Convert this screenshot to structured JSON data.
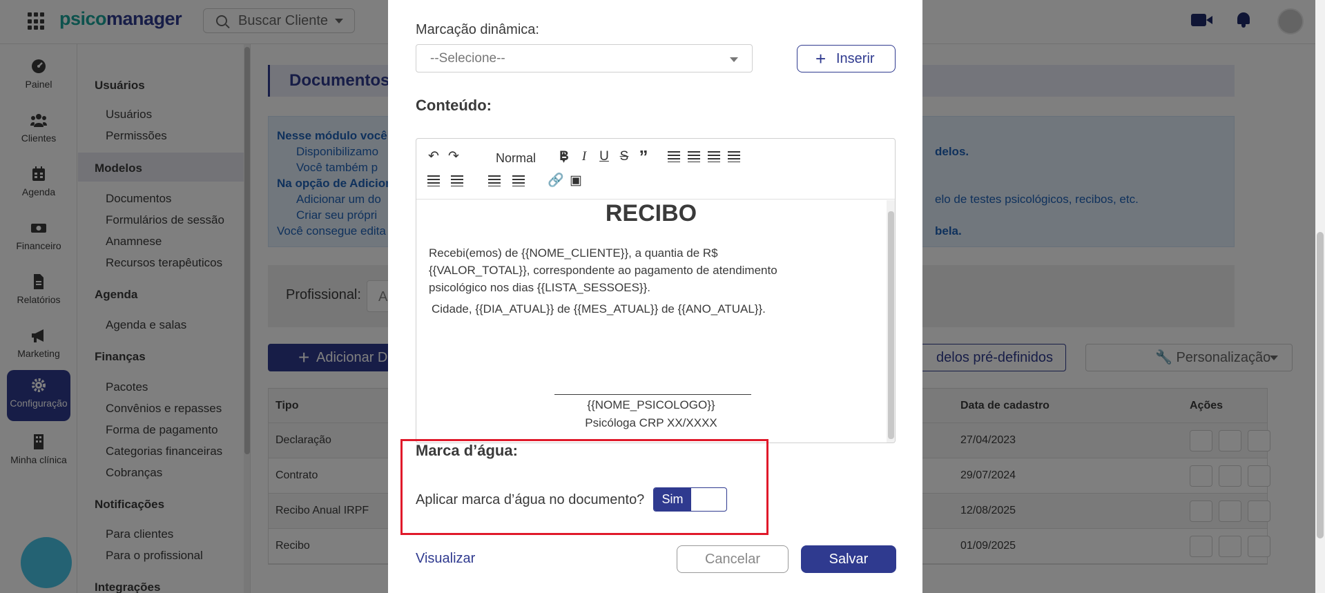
{
  "app": {
    "logo_part1": "psico",
    "logo_part2": "manager",
    "search_label": "Buscar Cliente"
  },
  "rail": {
    "items": [
      {
        "label": "Painel",
        "icon": "gauge-icon"
      },
      {
        "label": "Clientes",
        "icon": "users-icon"
      },
      {
        "label": "Agenda",
        "icon": "calendar-icon"
      },
      {
        "label": "Financeiro",
        "icon": "money-icon"
      },
      {
        "label": "Relatórios",
        "icon": "report-icon"
      },
      {
        "label": "Marketing",
        "icon": "megaphone-icon"
      },
      {
        "label": "Configuração",
        "icon": "gear-icon"
      },
      {
        "label": "Minha clínica",
        "icon": "building-icon"
      }
    ]
  },
  "submenu": {
    "usuarios": "Usuários",
    "usuarios_items": [
      "Usuários",
      "Permissões"
    ],
    "modelos": "Modelos",
    "modelos_items": [
      "Documentos",
      "Formulários de sessão",
      "Anamnese",
      "Recursos terapêuticos"
    ],
    "agenda": "Agenda",
    "agenda_items": [
      "Agenda e salas"
    ],
    "financas": "Finanças",
    "financas_items": [
      "Pacotes",
      "Convênios e repasses",
      "Forma de pagamento",
      "Categorias financeiras",
      "Cobranças"
    ],
    "notificacoes": "Notificações",
    "notificacoes_items": [
      "Para clientes",
      "Para o profissional"
    ],
    "integracoes": "Integrações"
  },
  "main": {
    "title": "Documentos",
    "info_lines": [
      "Nesse módulo você é",
      "Disponibilizamo",
      "Você também p",
      "Na opção de Adicion",
      "Adicionar um do",
      "Criar seu própri",
      "Você consegue edita"
    ],
    "info_right": [
      "delos.",
      "elo de testes psicológicos, recibos, etc.",
      "bela."
    ],
    "profissional_label": "Profissional:",
    "profissional_value": "A",
    "add_button": "Adicionar D",
    "predef_button": "delos pré-definidos",
    "perso_button": "Personalização",
    "table": {
      "headers": {
        "tipo": "Tipo",
        "data": "Data de cadastro",
        "acoes": "Ações"
      },
      "rows": [
        {
          "tipo": "Declaração",
          "data": "27/04/2023"
        },
        {
          "tipo": "Contrato",
          "data": "29/07/2024"
        },
        {
          "tipo": "Recibo Anual IRPF",
          "data": "12/08/2025"
        },
        {
          "tipo": "Recibo",
          "data": "01/09/2025"
        }
      ]
    }
  },
  "modal": {
    "marcacao_label": "Marcação dinâmica:",
    "marcacao_placeholder": "--Selecione--",
    "inserir_label": "Inserir",
    "conteudo_label": "Conteúdo:",
    "toolbar_format": "Normal",
    "doc": {
      "title": "RECIBO",
      "p1": "Recebi(emos) de {{NOME_CLIENTE}}, a quantia de R$ {{VALOR_TOTAL}}, correspondente ao pagamento de atendimento psicológico nos dias {{LISTA_SESSOES}}.",
      "p2": "Cidade, {{DIA_ATUAL}} de {{MES_ATUAL}} de {{ANO_ATUAL}}.",
      "signature_name": "{{NOME_PSICOLOGO}}",
      "signature_crp": "Psicóloga CRP XX/XXXX"
    },
    "marca_label": "Marca d’água:",
    "aplicar_label": "Aplicar marca d’água no documento?",
    "toggle_value": "Sim",
    "visualizar": "Visualizar",
    "cancelar": "Cancelar",
    "salvar": "Salvar"
  },
  "colors": {
    "primary": "#2f3a8f",
    "teal": "#1aa59a",
    "highlight": "#e0192a"
  }
}
